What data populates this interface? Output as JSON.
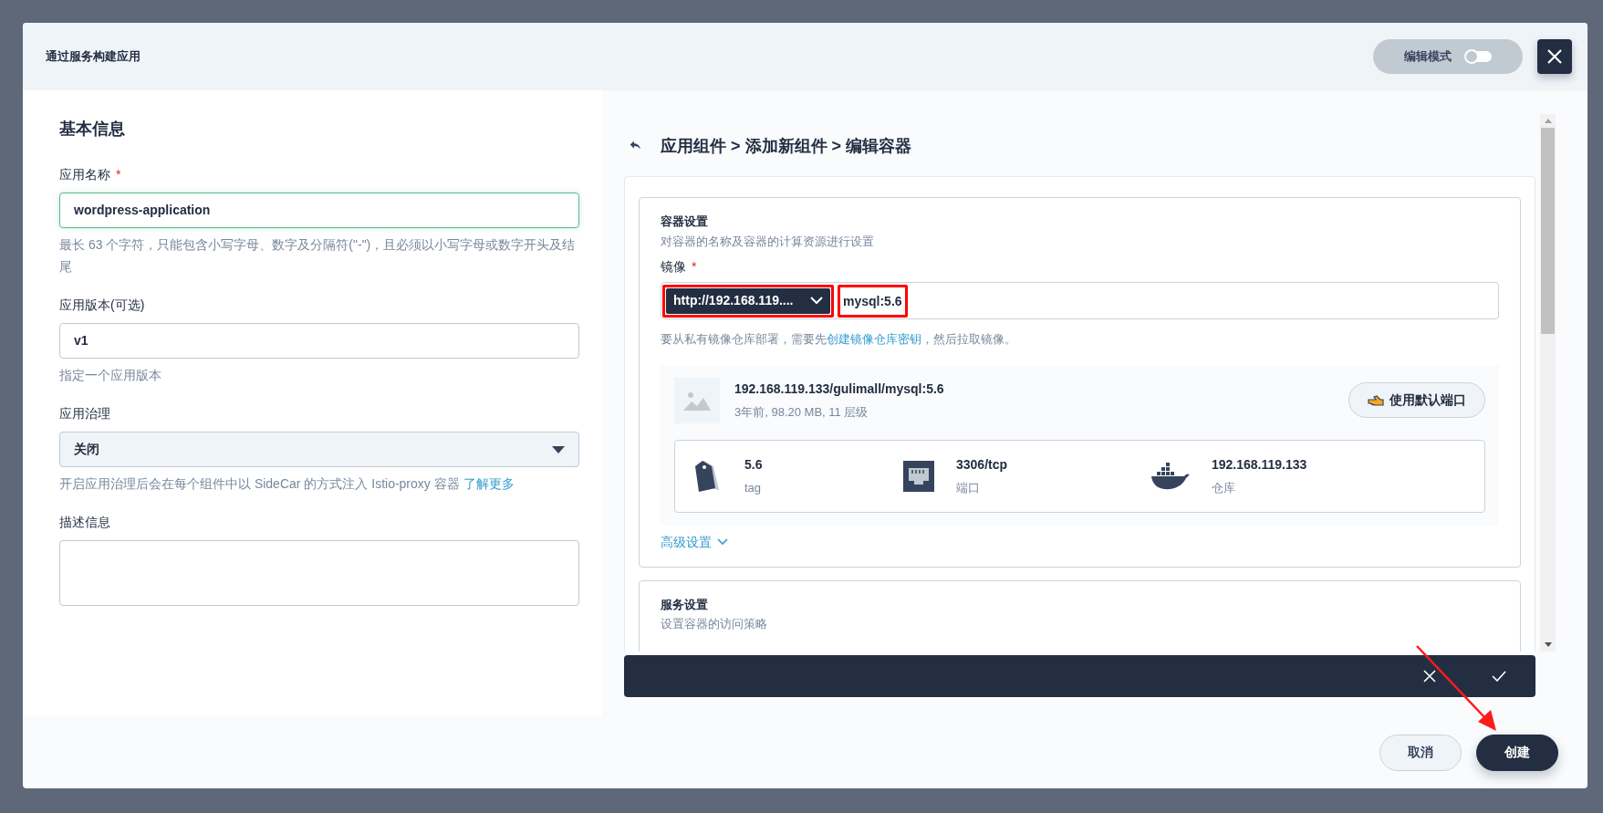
{
  "dialog": {
    "title": "通过服务构建应用",
    "edit_mode": {
      "label": "编辑模式",
      "on": false
    }
  },
  "basic_info": {
    "heading": "基本信息",
    "fields": [
      {
        "kind": "input",
        "label": "应用名称",
        "required_mark": "*",
        "focused": true,
        "value": "wordpress-application",
        "help": "最长 63 个字符，只能包含小写字母、数字及分隔符(\"-\")，且必须以小写字母或数字开头及结尾"
      },
      {
        "kind": "input",
        "label": "应用版本(可选)",
        "focused": false,
        "value": "v1",
        "help": "指定一个应用版本"
      },
      {
        "kind": "select",
        "label": "应用治理",
        "focused": false,
        "value": "关闭",
        "help": "开启应用治理后会在每个组件中以 SideCar 的方式注入 Istio-proxy 容器",
        "help_link": "了解更多"
      },
      {
        "kind": "textarea",
        "label": "描述信息",
        "focused": false
      }
    ]
  },
  "editor": {
    "breadcrumb": "应用组件 > 添加新组件 > 编辑容器",
    "container_settings": {
      "title": "容器设置",
      "description": "对容器的名称及容器的计算资源进行设置",
      "image_label": "镜像",
      "image_required_mark": "*",
      "registry": {
        "value": "http://192.168.119....",
        "highlighted": true
      },
      "image": {
        "value": "mysql:5.6",
        "highlighted": true
      },
      "hint_before": "要从私有镜像仓库部署，需要先",
      "hint_link": "创建镜像仓库密钥",
      "hint_after": "，然后拉取镜像。",
      "image_info": {
        "name": "192.168.119.133/gulimall/mysql:5.6",
        "meta": "3年前, 98.20 MB, 11 层级",
        "button": "使用默认端口"
      },
      "details": [
        {
          "kind": "tag",
          "value": "5.6",
          "label": "tag"
        },
        {
          "kind": "port",
          "value": "3306/tcp",
          "label": "端口"
        },
        {
          "kind": "registry",
          "value": "192.168.119.133",
          "label": "仓库"
        }
      ],
      "advanced": "高级设置"
    },
    "service_settings": {
      "title": "服务设置",
      "description": "设置容器的访问策略"
    }
  },
  "footer": {
    "buttons": [
      {
        "label": "取消",
        "kind": "secondary"
      },
      {
        "label": "创建",
        "kind": "primary"
      }
    ]
  }
}
